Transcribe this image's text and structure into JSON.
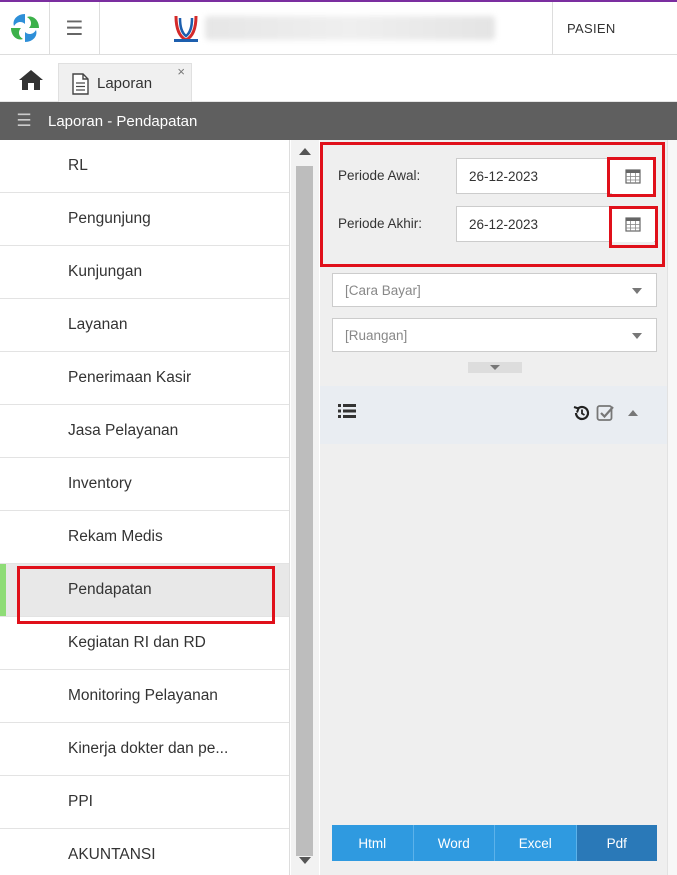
{
  "header": {
    "user_label": "PASIEN"
  },
  "tabs": [
    {
      "label": "Laporan",
      "close": "×"
    }
  ],
  "page_title": "Laporan - Pendapatan",
  "sidebar": {
    "items": [
      {
        "label": "RL"
      },
      {
        "label": "Pengunjung"
      },
      {
        "label": "Kunjungan"
      },
      {
        "label": "Layanan"
      },
      {
        "label": "Penerimaan Kasir"
      },
      {
        "label": "Jasa Pelayanan"
      },
      {
        "label": "Inventory"
      },
      {
        "label": "Rekam Medis"
      },
      {
        "label": "Pendapatan"
      },
      {
        "label": "Kegiatan RI dan RD"
      },
      {
        "label": "Monitoring Pelayanan"
      },
      {
        "label": "Kinerja dokter dan pe..."
      },
      {
        "label": "PPI"
      },
      {
        "label": "AKUNTANSI"
      }
    ],
    "active_index": 8
  },
  "filters": {
    "periode_awal_label": "Periode Awal:",
    "periode_awal_value": "26-12-2023",
    "periode_akhir_label": "Periode Akhir:",
    "periode_akhir_value": "26-12-2023",
    "cara_bayar": "[Cara Bayar]",
    "ruangan": "[Ruangan]"
  },
  "export": {
    "html": "Html",
    "word": "Word",
    "excel": "Excel",
    "pdf": "Pdf"
  },
  "colors": {
    "title_bar": "#5f5f5f",
    "active_marker": "#8edc76",
    "highlight": "#e0101a",
    "export_button": "#2f9ae0",
    "export_active": "#2a79b8"
  }
}
